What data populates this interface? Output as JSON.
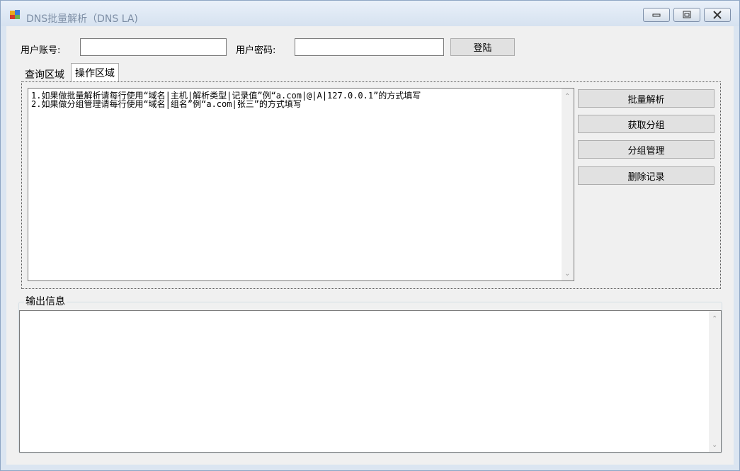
{
  "window": {
    "title": "DNS批量解析（DNS LA)",
    "controls": [
      "minimize-icon",
      "maximize-icon",
      "close-icon"
    ]
  },
  "login": {
    "account_label": "用户账号:",
    "account_value": "",
    "password_label": "用户密码:",
    "password_value": "",
    "login_button": "登陆"
  },
  "tabs": [
    {
      "label": "查询区域",
      "active": false
    },
    {
      "label": "操作区域",
      "active": true
    }
  ],
  "editor": {
    "text": "1.如果做批量解析请每行使用“域名|主机|解析类型|记录值”例“a.com|@|A|127.0.0.1”的方式填写\n2.如果做分组管理请每行使用“域名|组名”例“a.com|张三”的方式填写"
  },
  "actions": [
    "批量解析",
    "获取分组",
    "分组管理",
    "删除记录"
  ],
  "output": {
    "group_title": "输出信息",
    "text": ""
  }
}
